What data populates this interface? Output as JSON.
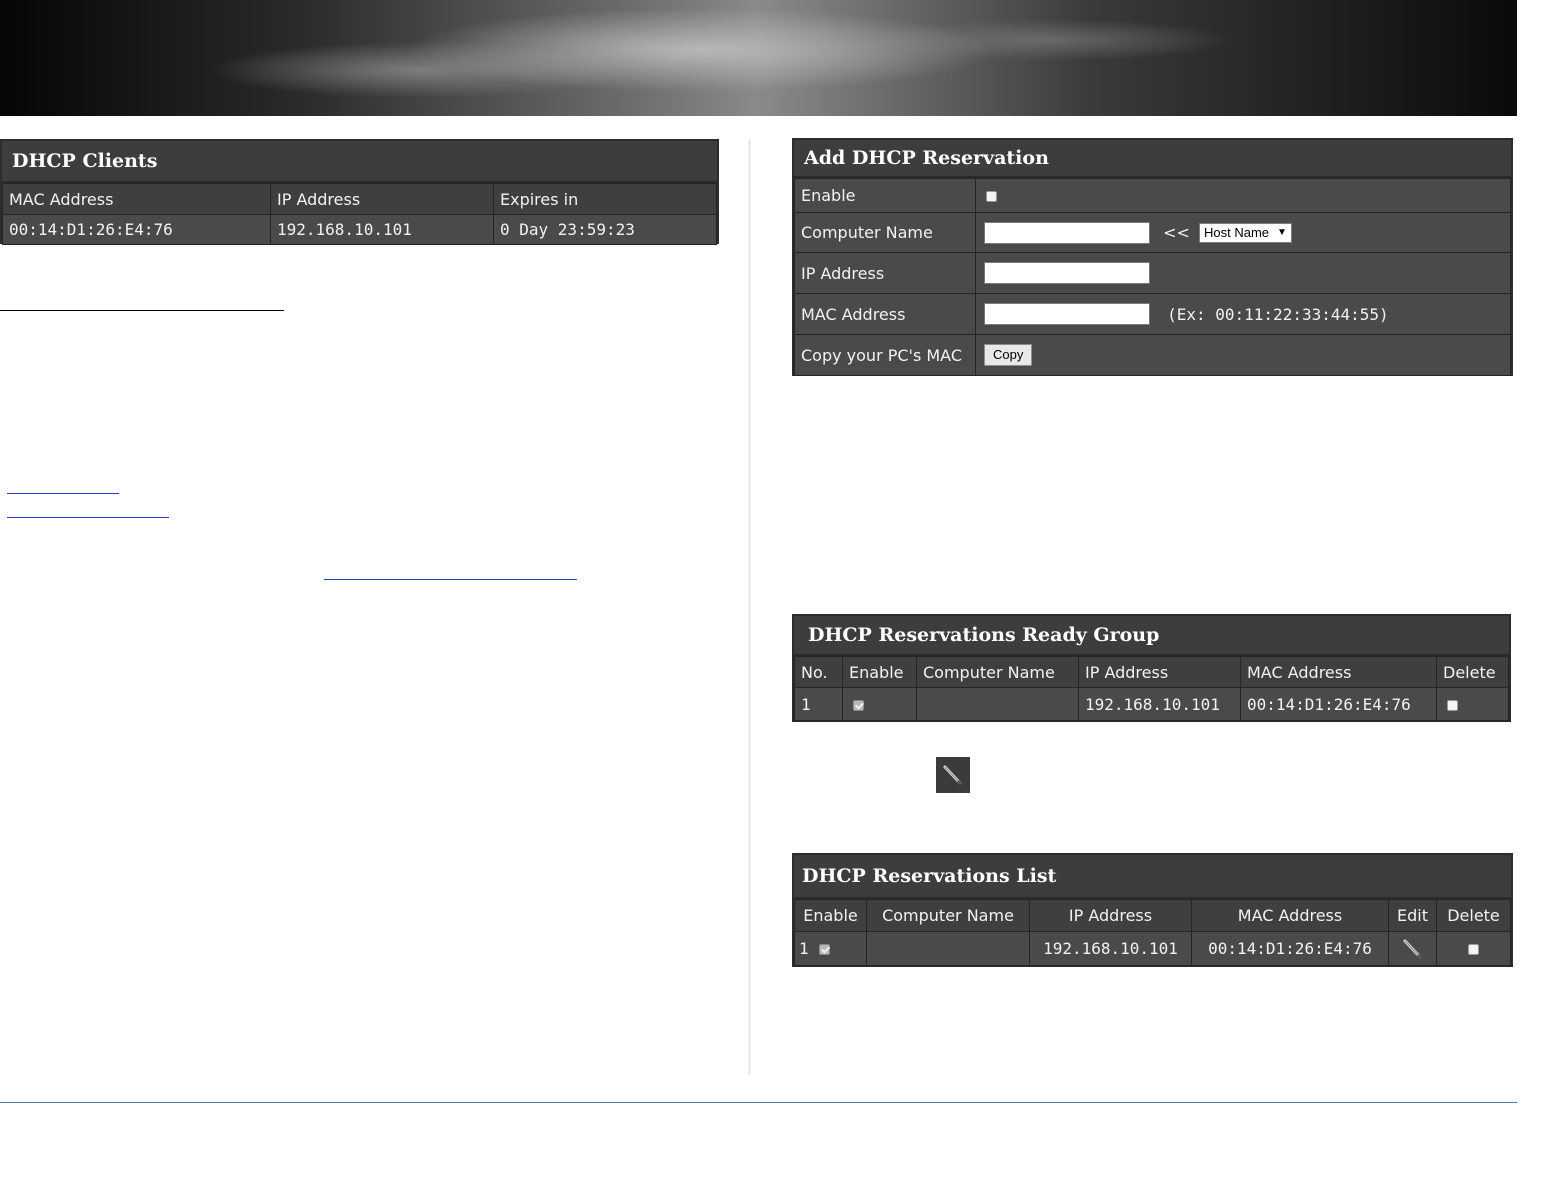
{
  "dhcp_clients": {
    "title": "DHCP Clients",
    "headers": [
      "MAC Address",
      "IP Address",
      "Expires in"
    ],
    "rows": [
      [
        "00:14:D1:26:E4:76",
        "192.168.10.101",
        "0 Day 23:59:23"
      ]
    ]
  },
  "add_reservation": {
    "title": "Add DHCP Reservation",
    "enable_label": "Enable",
    "computer_name_label": "Computer Name",
    "arrows": "<<",
    "host_select": "Host Name",
    "ip_label": "IP Address",
    "mac_label": "MAC Address",
    "mac_hint": "(Ex: 00:11:22:33:44:55)",
    "copy_mac_label": "Copy your PC's MAC",
    "copy_button": "Copy"
  },
  "ready_group": {
    "title": "DHCP Reservations Ready Group",
    "headers": [
      "No.",
      "Enable",
      "Computer Name",
      "IP Address",
      "MAC Address",
      "Delete"
    ],
    "row": {
      "no": "1",
      "computer_name": "",
      "ip": "192.168.10.101",
      "mac": "00:14:D1:26:E4:76"
    }
  },
  "reservations_list": {
    "title": "DHCP Reservations List",
    "headers": [
      "Enable",
      "Computer Name",
      "IP Address",
      "MAC Address",
      "Edit",
      "Delete"
    ],
    "row": {
      "no": "1",
      "computer_name": "",
      "ip": "192.168.10.101",
      "mac": "00:14:D1:26:E4:76"
    }
  },
  "icons": {
    "edit": "pencil-icon",
    "checkbox": "checkbox-icon"
  },
  "colors": {
    "panel_bg": "#3b3b3b",
    "cell_bg": "#4a4a4a",
    "footer_rule": "#4f81bd",
    "link": "#1f3fbf"
  }
}
